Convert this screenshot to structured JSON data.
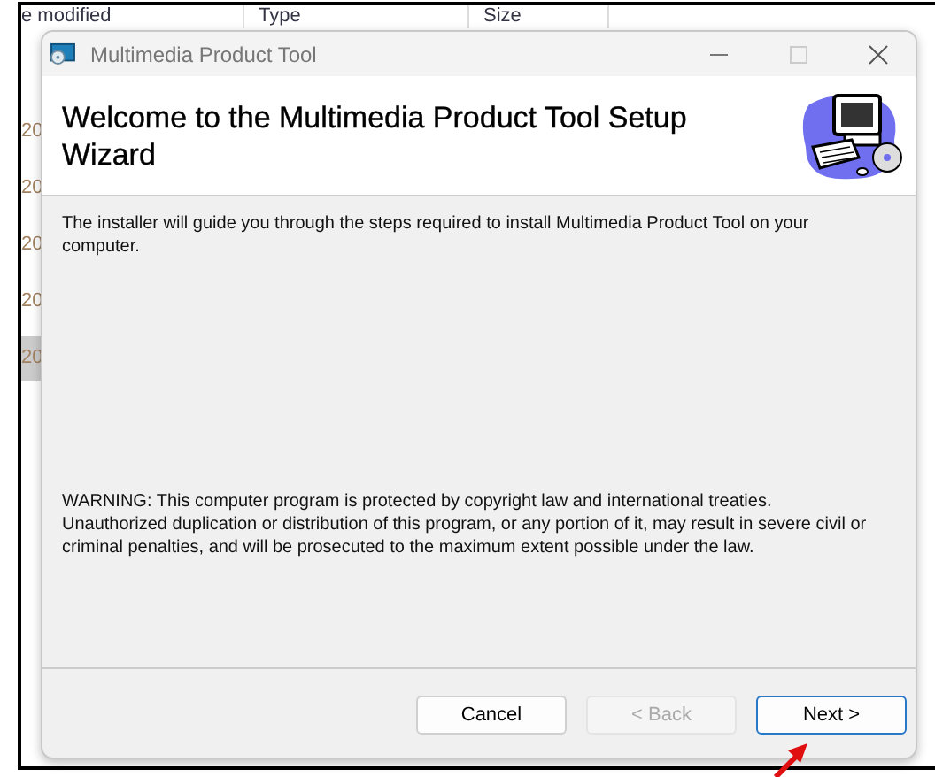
{
  "background_list": {
    "columns": [
      "e modified",
      "Type",
      "Size"
    ],
    "rows": [
      {
        "cell": "20",
        "selected": false
      },
      {
        "cell": "20",
        "selected": false
      },
      {
        "cell": "20",
        "selected": false
      },
      {
        "cell": "20",
        "selected": false
      },
      {
        "cell": "20",
        "selected": true
      }
    ]
  },
  "window": {
    "title": "Multimedia Product Tool"
  },
  "header": {
    "title": "Welcome to the Multimedia Product Tool Setup Wizard"
  },
  "body": {
    "intro": "The installer will guide you through the steps required to install Multimedia Product Tool on your computer.",
    "warning": "WARNING: This computer program is protected by copyright law and international treaties. Unauthorized duplication or distribution of this program, or any portion of it, may result in severe civil or criminal penalties, and will be prosecuted to the maximum extent possible under the law."
  },
  "buttons": [
    {
      "label": "Cancel",
      "disabled": false,
      "default": false
    },
    {
      "label": "< Back",
      "disabled": true,
      "default": false
    },
    {
      "label": "Next >",
      "disabled": false,
      "default": true
    }
  ]
}
